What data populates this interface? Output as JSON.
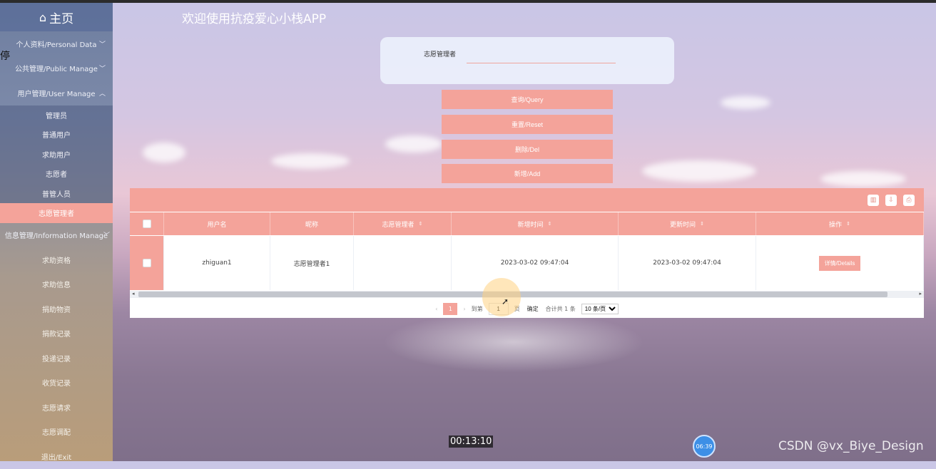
{
  "header": {
    "home_label": "主页",
    "app_title": "欢迎使用抗疫爱心小栈APP"
  },
  "sidebar": {
    "edge_glyph": "停",
    "menus": [
      {
        "label": "个人资料/Personal Data"
      },
      {
        "label": "公共管理/Public Manage"
      },
      {
        "label": "用户管理/User Manage"
      }
    ],
    "user_items": [
      "管理员",
      "普通用户",
      "求助用户",
      "志愿者",
      "普管人员",
      "志愿管理者"
    ],
    "info_menu": "信息管理/Information Manage",
    "info_items": [
      "求助资格",
      "求助信息",
      "捐助物资",
      "捐款记录",
      "投递记录",
      "收货记录",
      "志愿请求",
      "志愿调配",
      "退出/Exit"
    ]
  },
  "search": {
    "label": "志愿管理者",
    "value": "",
    "placeholder": ""
  },
  "buttons": {
    "query": "查询/Query",
    "reset": "重置/Reset",
    "delete": "删除/Del",
    "add": "新增/Add"
  },
  "table": {
    "columns": [
      "用户名",
      "昵称",
      "志愿管理者",
      "新增时间",
      "更新时间",
      "操作"
    ],
    "rows": [
      {
        "username": "zhiguan1",
        "nickname": "志愿管理者1",
        "manager": "",
        "created": "2023-03-02 09:47:04",
        "updated": "2023-03-02 09:47:04",
        "action": "详情/Details"
      }
    ]
  },
  "pager": {
    "current": "1",
    "goto_label": "到第",
    "goto_value": "1",
    "page_label": "页",
    "confirm": "确定",
    "total": "合计共 1 条",
    "per_page": "10 条/页"
  },
  "overlay": {
    "timer": "00:13:10",
    "clock": "06:39",
    "watermark": "CSDN @vx_Biye_Design"
  },
  "colors": {
    "accent": "#f4a39a"
  }
}
